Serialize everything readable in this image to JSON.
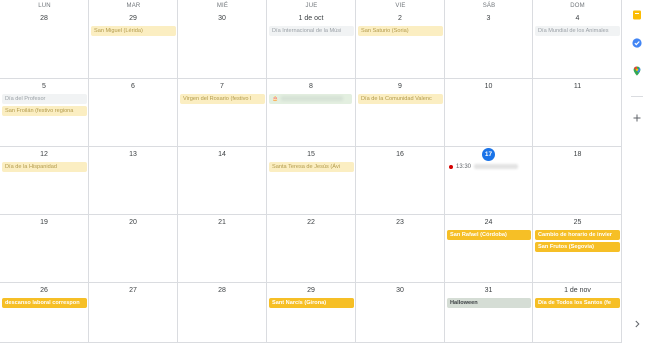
{
  "weekdays": [
    "LUN",
    "MAR",
    "MIÉ",
    "JUE",
    "VIE",
    "SÁB",
    "DOM"
  ],
  "weeks": [
    {
      "dates": [
        "28",
        "29",
        "30",
        "1 de oct",
        "2",
        "3",
        "4"
      ],
      "events": [
        {
          "col": 1,
          "label": "San Miguel (Lérida)",
          "style": "yellow"
        },
        {
          "col": 3,
          "label": "Día Internacional de la Músi",
          "style": "gray"
        },
        {
          "col": 4,
          "label": "San Saturio (Soria)",
          "style": "yellow"
        },
        {
          "col": 6,
          "label": "Día Mundial de los Animales",
          "style": "gray"
        }
      ]
    },
    {
      "dates": [
        "5",
        "6",
        "7",
        "8",
        "9",
        "10",
        "11"
      ],
      "events": [
        {
          "col": 0,
          "label": "Día del Profesor",
          "style": "gray"
        },
        {
          "col": 0,
          "label": "San Froilán (festivo regiona",
          "style": "yellow",
          "slot": 1
        },
        {
          "col": 2,
          "label": "Virgen del Rosario (festivo l",
          "style": "yellow"
        },
        {
          "col": 4,
          "label": "Día de la Comunidad Valenc",
          "style": "yellow"
        }
      ]
    },
    {
      "dates": [
        "12",
        "13",
        "14",
        "15",
        "16",
        "17",
        "18"
      ],
      "events": [
        {
          "col": 0,
          "label": "Día de la Hispanidad",
          "style": "yellow"
        },
        {
          "col": 3,
          "label": "Santa Teresa de Jesús (Ávi",
          "style": "yellow"
        }
      ]
    },
    {
      "dates": [
        "19",
        "20",
        "21",
        "22",
        "23",
        "24",
        "25"
      ],
      "events": [
        {
          "col": 5,
          "label": "San Rafael (Córdoba)",
          "style": "yellow-solid"
        },
        {
          "col": 6,
          "label": "Cambio de horario de invier",
          "style": "yellow-solid"
        },
        {
          "col": 6,
          "label": "San Frutos (Segovia)",
          "style": "yellow-solid",
          "slot": 1
        }
      ]
    },
    {
      "dates": [
        "26",
        "27",
        "28",
        "29",
        "30",
        "31",
        "1 de nov"
      ],
      "events": [
        {
          "col": 0,
          "label": "descanso laboral correspon",
          "style": "yellow-solid"
        },
        {
          "col": 3,
          "label": "Sant Narcís (Girona)",
          "style": "yellow-solid"
        },
        {
          "col": 5,
          "label": "Halloween",
          "style": "gray-solid"
        },
        {
          "col": 6,
          "label": "Día de Todos los Santos (fe",
          "style": "yellow-solid"
        }
      ]
    }
  ],
  "today": {
    "label": "17"
  },
  "timed_event": {
    "time": "13:30",
    "color": "#d50000"
  },
  "side_panel": {
    "icons": [
      "keep-icon",
      "tasks-icon",
      "maps-icon",
      "add-icon",
      "chevron-right-icon"
    ]
  },
  "colors": {
    "today_accent": "#1a73e8",
    "holiday_bg": "#fbeec2",
    "holiday_solid": "#f6bf26"
  }
}
